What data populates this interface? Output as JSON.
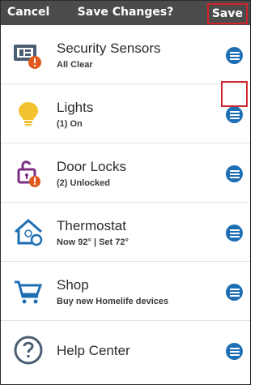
{
  "header": {
    "cancel_label": "Cancel",
    "title": "Save Changes?",
    "save_label": "Save"
  },
  "items": [
    {
      "title": "Security Sensors",
      "subtitle": "All Clear",
      "icon": "security-sensors-icon"
    },
    {
      "title": "Lights",
      "subtitle": "(1) On",
      "icon": "lightbulb-icon"
    },
    {
      "title": "Door Locks",
      "subtitle": "(2) Unlocked",
      "icon": "lock-icon"
    },
    {
      "title": "Thermostat",
      "subtitle": "Now 92° | Set 72°",
      "icon": "thermostat-house-icon"
    },
    {
      "title": "Shop",
      "subtitle": "Buy new Homelife devices",
      "icon": "shopping-cart-icon"
    },
    {
      "title": "Help Center",
      "subtitle": "",
      "icon": "help-icon"
    }
  ],
  "colors": {
    "header_bg": "#4b4b4b",
    "accent_blue": "#1d6fb4",
    "highlight_red": "#d1232a",
    "alert_orange": "#e05a1f",
    "bulb_yellow": "#f2c230",
    "lock_purple": "#7d2f85"
  }
}
